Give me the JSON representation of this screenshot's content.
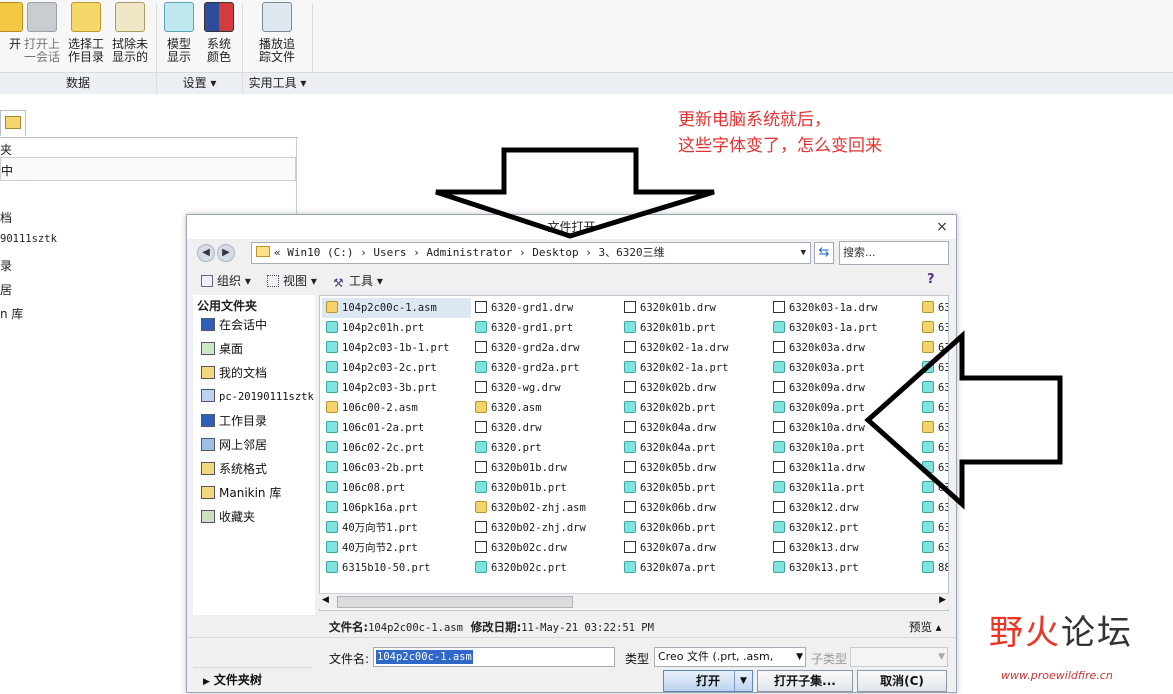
{
  "ribbon": {
    "buttons": [
      {
        "label": "开",
        "name": "open"
      },
      {
        "label": "打开上\n一会话",
        "name": "open-last-session"
      },
      {
        "label": "选择工\n作目录",
        "name": "select-working-dir"
      },
      {
        "label": "拭除未\n显示的",
        "name": "erase-not-displayed"
      },
      {
        "label": "模型\n显示",
        "name": "model-display"
      },
      {
        "label": "系统\n颜色",
        "name": "system-colors"
      },
      {
        "label": "播放追\n踪文件",
        "name": "play-trail-file"
      }
    ],
    "groups": [
      "数据",
      "设置 ▾",
      "实用工具 ▾"
    ]
  },
  "left_panel": {
    "rows": [
      "夹",
      "中",
      "档",
      "90111sztk",
      "录",
      "居",
      "n 库"
    ]
  },
  "annotation": {
    "line1": "更新电脑系统就后，",
    "line2": "这些字体变了，怎么变回来"
  },
  "dialog": {
    "title": "文件打开",
    "close": "×",
    "address": "« Win10 (C:) › Users › Administrator › Desktop › 3、6320三维",
    "search_placeholder": "搜索...",
    "toolbar": {
      "organize": "组织 ▾",
      "views": "视图 ▾",
      "tools": "工具 ▾"
    },
    "sidebar": {
      "header": "公用文件夹",
      "items": [
        "在会话中",
        "桌面",
        "我的文档",
        "pc-20190111sztk",
        "工作目录",
        "网上邻居",
        "系统格式",
        "Manikin 库",
        "收藏夹"
      ],
      "folder_tree": "文件夹树"
    },
    "files": {
      "col1": [
        {
          "n": "104p2c00c-1.asm",
          "t": "asm"
        },
        {
          "n": "104p2c01h.prt",
          "t": "prt"
        },
        {
          "n": "104p2c03-1b-1.prt",
          "t": "prt"
        },
        {
          "n": "104p2c03-2c.prt",
          "t": "prt"
        },
        {
          "n": "104p2c03-3b.prt",
          "t": "prt"
        },
        {
          "n": "106c00-2.asm",
          "t": "asm"
        },
        {
          "n": "106c01-2a.prt",
          "t": "prt"
        },
        {
          "n": "106c02-2c.prt",
          "t": "prt"
        },
        {
          "n": "106c03-2b.prt",
          "t": "prt"
        },
        {
          "n": "106c08.prt",
          "t": "prt"
        },
        {
          "n": "106pk16a.prt",
          "t": "prt"
        },
        {
          "n": "40万向节1.prt",
          "t": "prt"
        },
        {
          "n": "40万向节2.prt",
          "t": "prt"
        },
        {
          "n": "6315b10-50.prt",
          "t": "prt"
        }
      ],
      "col2": [
        {
          "n": "6320-grd1.drw",
          "t": "drw"
        },
        {
          "n": "6320-grd1.prt",
          "t": "prt"
        },
        {
          "n": "6320-grd2a.drw",
          "t": "drw"
        },
        {
          "n": "6320-grd2a.prt",
          "t": "prt"
        },
        {
          "n": "6320-wg.drw",
          "t": "drw"
        },
        {
          "n": "6320.asm",
          "t": "asm"
        },
        {
          "n": "6320.drw",
          "t": "drw"
        },
        {
          "n": "6320.prt",
          "t": "prt"
        },
        {
          "n": "6320b01b.drw",
          "t": "drw"
        },
        {
          "n": "6320b01b.prt",
          "t": "prt"
        },
        {
          "n": "6320b02-zhj.asm",
          "t": "asm"
        },
        {
          "n": "6320b02-zhj.drw",
          "t": "drw"
        },
        {
          "n": "6320b02c.drw",
          "t": "drw"
        },
        {
          "n": "6320b02c.prt",
          "t": "prt"
        }
      ],
      "col3": [
        {
          "n": "6320k01b.drw",
          "t": "drw"
        },
        {
          "n": "6320k01b.prt",
          "t": "prt"
        },
        {
          "n": "6320k02-1a.drw",
          "t": "drw"
        },
        {
          "n": "6320k02-1a.prt",
          "t": "prt"
        },
        {
          "n": "6320k02b.drw",
          "t": "drw"
        },
        {
          "n": "6320k02b.prt",
          "t": "prt"
        },
        {
          "n": "6320k04a.drw",
          "t": "drw"
        },
        {
          "n": "6320k04a.prt",
          "t": "prt"
        },
        {
          "n": "6320k05b.drw",
          "t": "drw"
        },
        {
          "n": "6320k05b.prt",
          "t": "prt"
        },
        {
          "n": "6320k06b.drw",
          "t": "drw"
        },
        {
          "n": "6320k06b.prt",
          "t": "prt"
        },
        {
          "n": "6320k07a.drw",
          "t": "drw"
        },
        {
          "n": "6320k07a.prt",
          "t": "prt"
        }
      ],
      "col4": [
        {
          "n": "6320k03-1a.drw",
          "t": "drw"
        },
        {
          "n": "6320k03-1a.prt",
          "t": "prt"
        },
        {
          "n": "6320k03a.drw",
          "t": "drw"
        },
        {
          "n": "6320k03a.prt",
          "t": "prt"
        },
        {
          "n": "6320k09a.drw",
          "t": "drw"
        },
        {
          "n": "6320k09a.prt",
          "t": "prt"
        },
        {
          "n": "6320k10a.drw",
          "t": "drw"
        },
        {
          "n": "6320k10a.prt",
          "t": "prt"
        },
        {
          "n": "6320k11a.drw",
          "t": "drw"
        },
        {
          "n": "6320k11a.prt",
          "t": "prt"
        },
        {
          "n": "6320k12.drw",
          "t": "drw"
        },
        {
          "n": "6320k12.prt",
          "t": "prt"
        },
        {
          "n": "6320k13.drw",
          "t": "drw"
        },
        {
          "n": "6320k13.prt",
          "t": "prt"
        }
      ],
      "col5": [
        {
          "n": "63",
          "t": "asm"
        },
        {
          "n": "63",
          "t": "asm"
        },
        {
          "n": "63",
          "t": "asm"
        },
        {
          "n": "63",
          "t": "prt"
        },
        {
          "n": "63",
          "t": "prt"
        },
        {
          "n": "63",
          "t": "prt"
        },
        {
          "n": "63",
          "t": "asm"
        },
        {
          "n": "63",
          "t": "prt"
        },
        {
          "n": "63",
          "t": "prt"
        },
        {
          "n": "63",
          "t": "prt"
        },
        {
          "n": "63",
          "t": "prt"
        },
        {
          "n": "63",
          "t": "prt"
        },
        {
          "n": "63",
          "t": "prt"
        },
        {
          "n": "88",
          "t": "prt"
        }
      ]
    },
    "info": {
      "name_label": "文件名:",
      "name_value": "104p2c00c-1.asm",
      "date_label": "修改日期:",
      "date_value": "11-May-21 03:22:51 PM",
      "preview": "预览 ▴"
    },
    "filename_label": "文件名:",
    "filename_value": "104p2c00c-1.asm",
    "type_label": "类型",
    "type_value": "Creo 文件 (.prt, .asm,",
    "subtype_label": "子类型",
    "buttons": {
      "open": "打开",
      "open_sub": "打开子集...",
      "cancel": "取消(C)"
    }
  },
  "watermark": {
    "brand": "野火论坛",
    "url": "www.proewildfire.cn"
  }
}
